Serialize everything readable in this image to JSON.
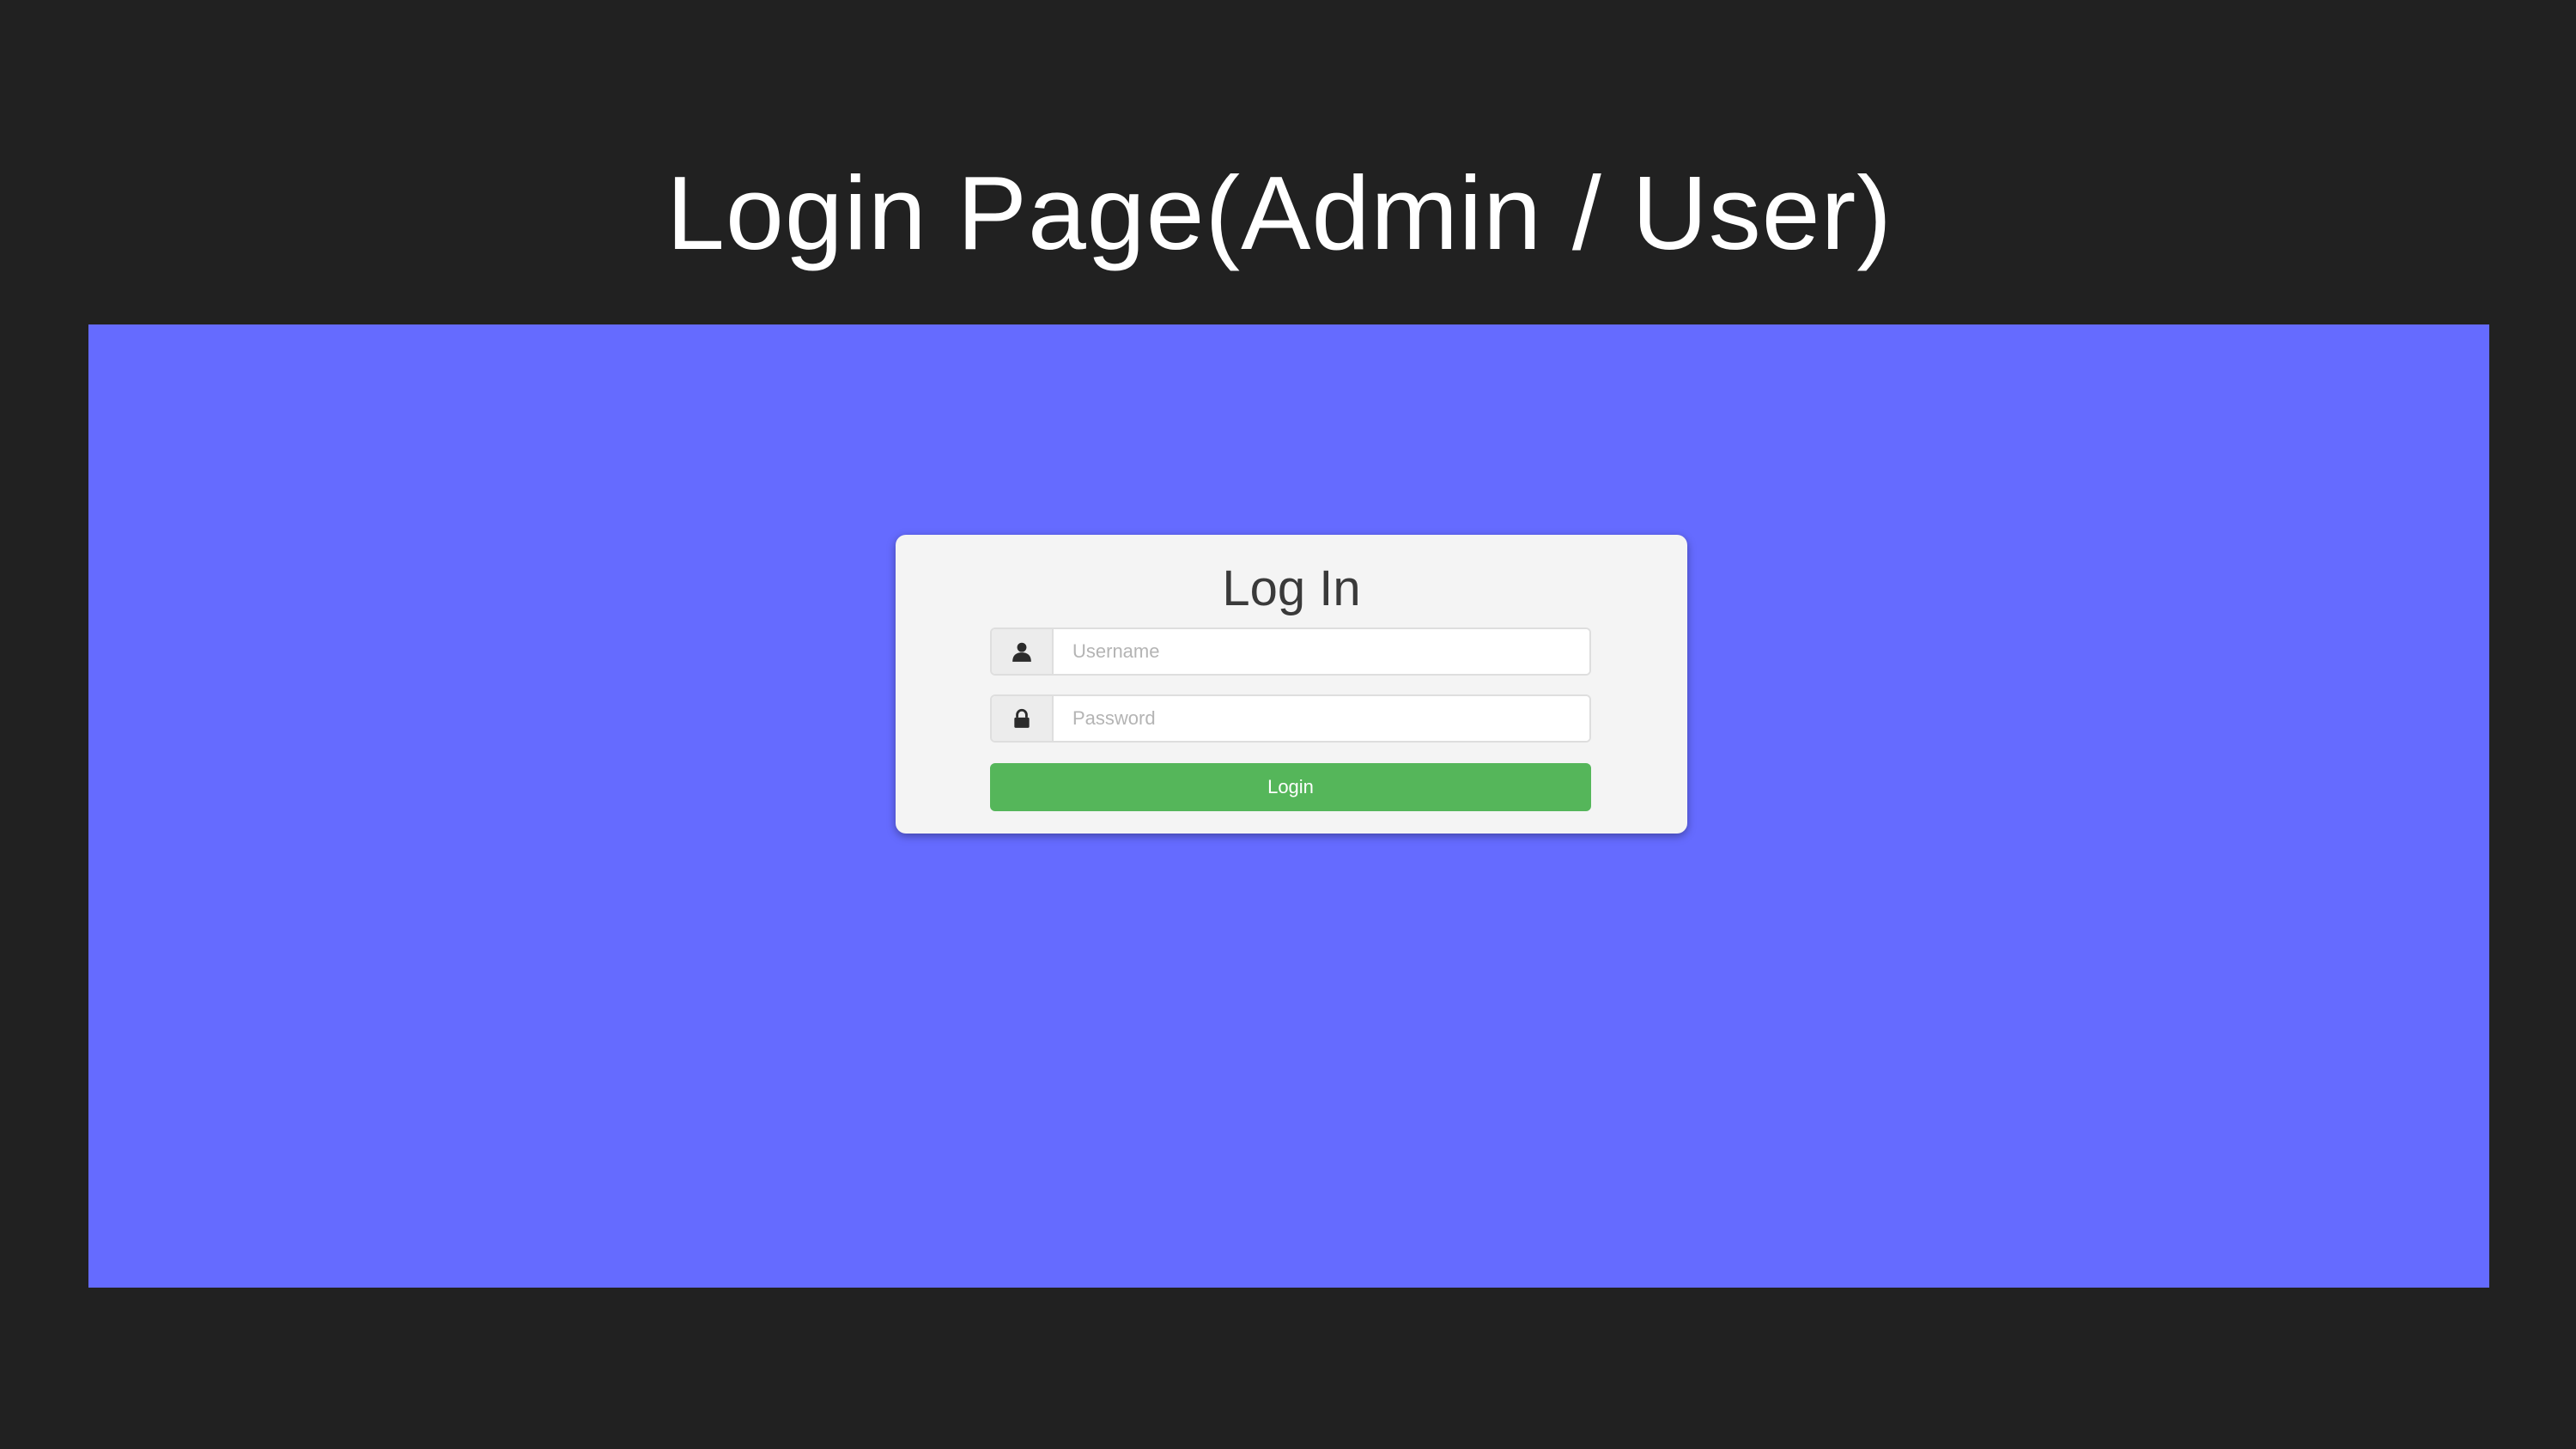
{
  "slide": {
    "title": "Login Page(Admin / User)"
  },
  "login_form": {
    "heading": "Log In",
    "username": {
      "placeholder": "Username",
      "value": "",
      "icon": "user-icon"
    },
    "password": {
      "placeholder": "Password",
      "value": "",
      "icon": "lock-icon"
    },
    "submit_label": "Login"
  },
  "colors": {
    "slide_background": "#212121",
    "page_background": "#656bff",
    "card_background": "#f4f4f4",
    "button_green": "#55b65a"
  }
}
